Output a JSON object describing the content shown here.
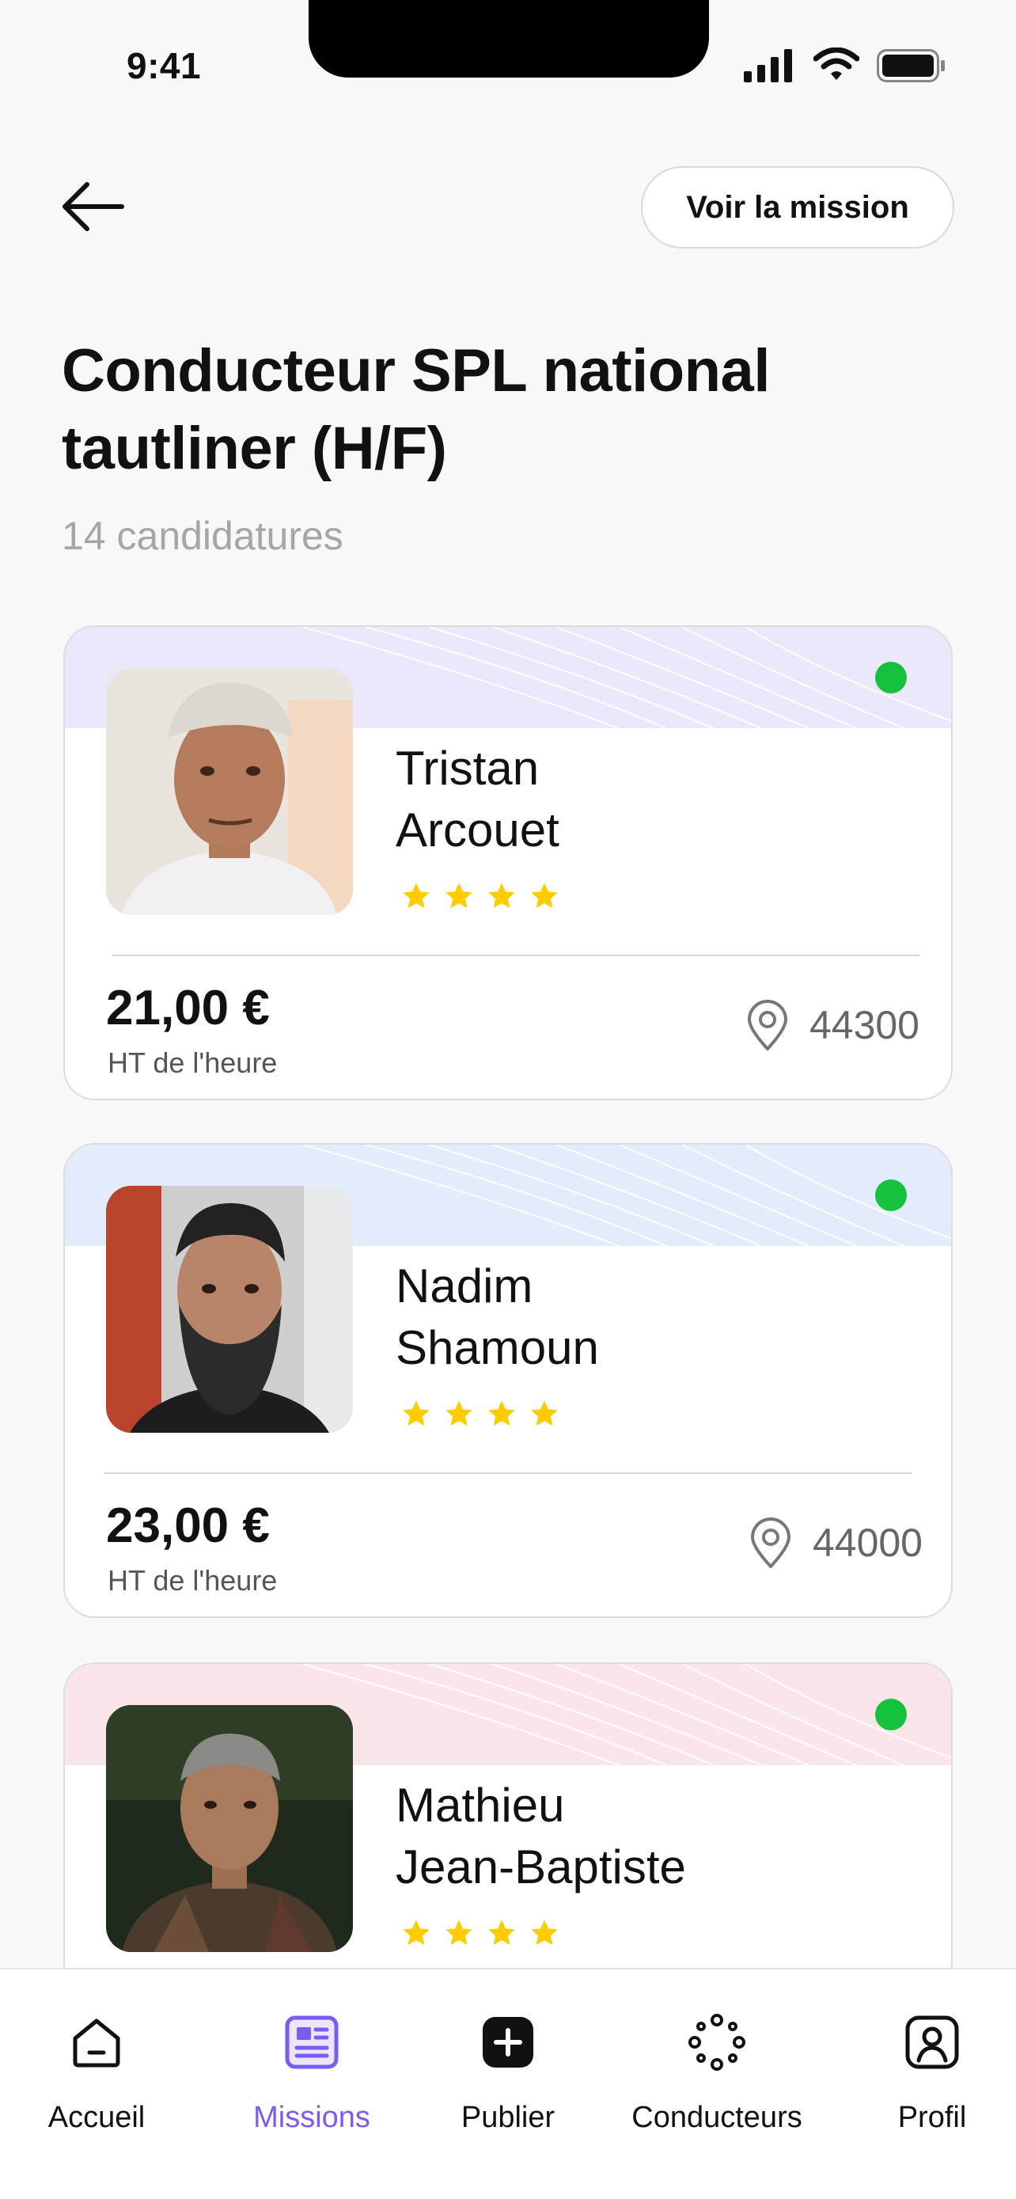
{
  "status_bar": {
    "time": "9:41"
  },
  "header": {
    "view_mission_label": "Voir la mission"
  },
  "title_line1": "Conducteur SPL national",
  "title_line2": "tautliner (H/F)",
  "applications_count": "14 candidatures",
  "candidates": [
    {
      "first_name": "Tristan",
      "last_name": "Arcouet",
      "rating": 4,
      "price": "21,00 €",
      "price_unit": "HT de l'heure",
      "postal_code": "44300",
      "online": true,
      "band_color": "#ece8fb"
    },
    {
      "first_name": "Nadim",
      "last_name": "Shamoun",
      "rating": 4,
      "price": "23,00 €",
      "price_unit": "HT de l'heure",
      "postal_code": "44000",
      "online": true,
      "band_color": "#e2ecfa"
    },
    {
      "first_name": "Mathieu",
      "last_name": "Jean-Baptiste",
      "rating": 4,
      "online": true,
      "band_color": "#fae6ea"
    }
  ],
  "bottom_nav": [
    {
      "label": "Accueil",
      "icon": "home-icon",
      "active": false
    },
    {
      "label": "Missions",
      "icon": "missions-icon",
      "active": true
    },
    {
      "label": "Publier",
      "icon": "plus-icon",
      "active": false
    },
    {
      "label": "Conducteurs",
      "icon": "drivers-icon",
      "active": false
    },
    {
      "label": "Profil",
      "icon": "profile-icon",
      "active": false
    }
  ],
  "colors": {
    "accent": "#7b5cf0",
    "online": "#16c13d",
    "star": "#ffcc00"
  }
}
